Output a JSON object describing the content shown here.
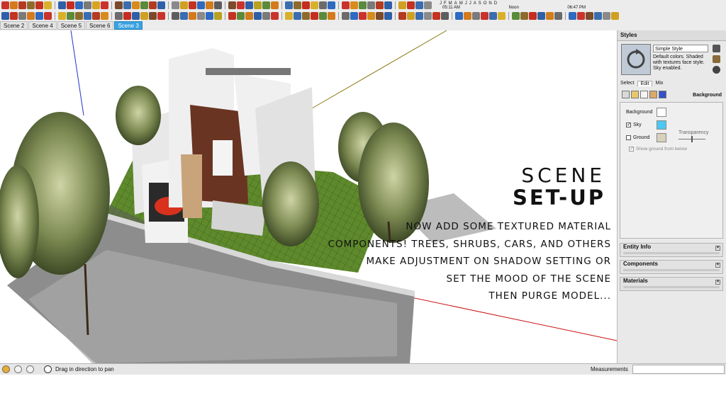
{
  "toolbar": {
    "row1_colors": [
      "#c9332b",
      "#d47a1c",
      "#b33b22",
      "#8e6b2c",
      "#c43220",
      "#d9b02a",
      "#2f5fa8",
      "#c42d1f",
      "#2d6ac0",
      "#7a7a7a",
      "#d9a320",
      "#c9332b",
      "#7a4a2a",
      "#3a6db0",
      "#d88a1c",
      "#5a8a3a",
      "#b33b22",
      "#2f5fa8",
      "#8a8a8a",
      "#d0a020",
      "#c43220",
      "#2d6ac0",
      "#d17d1c",
      "#5d5d5d",
      "#7a4a2a",
      "#c9332b",
      "#2f5fa8",
      "#b8a020",
      "#5a8a3a",
      "#d47a1c",
      "#3a6db0",
      "#8e6b2c",
      "#c42d1f",
      "#d9b02a",
      "#6b6b6b",
      "#2d6ac0",
      "#c9332b",
      "#d88a1c",
      "#5a8a3a",
      "#7a7a7a",
      "#b33b22",
      "#2f5fa8",
      "#d0a020",
      "#c43220",
      "#3a6db0",
      "#8a8a8a"
    ],
    "row2_colors": [
      "#2f5fa8",
      "#c43220",
      "#7a7a7a",
      "#d47a1c",
      "#2d6ac0",
      "#c9332b",
      "#d9b02a",
      "#5a8a3a",
      "#8e6b2c",
      "#3a6db0",
      "#b33b22",
      "#d88a1c",
      "#6b6b6b",
      "#c42d1f",
      "#2f5fa8",
      "#d0a020",
      "#7a4a2a",
      "#c9332b",
      "#5d5d5d",
      "#3a6db0",
      "#d47a1c",
      "#8a8a8a",
      "#2d6ac0",
      "#b8a020",
      "#c43220",
      "#5a8a3a",
      "#d17d1c",
      "#2f5fa8",
      "#7a7a7a",
      "#c9332b",
      "#d9b02a",
      "#3a6db0",
      "#8e6b2c",
      "#c42d1f",
      "#5a8a3a",
      "#d47a1c",
      "#6b6b6b",
      "#2d6ac0",
      "#c9332b",
      "#d88a1c",
      "#7a4a2a",
      "#2f5fa8",
      "#b33b22",
      "#d0a020",
      "#3a6db0",
      "#8a8a8a",
      "#c43220",
      "#5d5d5d",
      "#2d6ac0",
      "#d47a1c",
      "#7a7a7a",
      "#c9332b",
      "#3a6db0",
      "#d9b02a",
      "#5a8a3a",
      "#8e6b2c",
      "#c42d1f",
      "#2f5fa8",
      "#d17d1c",
      "#6b6b6b",
      "#2d6ac0",
      "#c9332b",
      "#7a4a2a",
      "#3a6db0",
      "#8a8a8a",
      "#d0a020"
    ],
    "shadow_months": [
      "J",
      "F",
      "M",
      "A",
      "M",
      "J",
      "J",
      "A",
      "S",
      "O",
      "N",
      "D"
    ],
    "shadow_time_start": "05:11 AM",
    "shadow_time_noon": "Noon",
    "shadow_time_end": "06:47 PM"
  },
  "scene_tabs": [
    "Scene 2",
    "Scene 4",
    "Scene 5",
    "Scene 6",
    "Scene 3"
  ],
  "active_scene_index": 4,
  "overlay": {
    "title_line1": "SCENE",
    "title_line2": "SET-UP",
    "lines": [
      "NOW ADD SOME TEXTURED MATERIAL",
      "COMPONENTS! TREES, SHRUBS, CARS, AND OTHERS",
      "MAKE ADJUSTMENT ON SHADOW SETTING OR",
      "SET THE MOOD OF THE SCENE",
      "THEN PURGE MODEL..."
    ]
  },
  "styles_panel": {
    "title": "Styles",
    "style_name": "Simple Style",
    "style_description": "Default colors.  Shaded with textures face style.  Sky enabled.",
    "tabs": [
      "Select",
      "Edit",
      "Mix"
    ],
    "active_tab": "Edit",
    "edit_section": "Background",
    "background_label": "Background",
    "sky_label": "Sky",
    "sky_checked": true,
    "ground_label": "Ground",
    "ground_checked": false,
    "transparency_label": "Transparency",
    "show_ground_label": "Show ground from below",
    "colors": {
      "background": "#ffffff",
      "sky": "#4cc8f2",
      "ground": "#d6d0bc"
    }
  },
  "collapsed_panels": [
    "Entity Info",
    "Components",
    "Materials"
  ],
  "status": {
    "message": "Drag in direction to pan",
    "measurements_label": "Measurements",
    "measurements_value": ""
  }
}
